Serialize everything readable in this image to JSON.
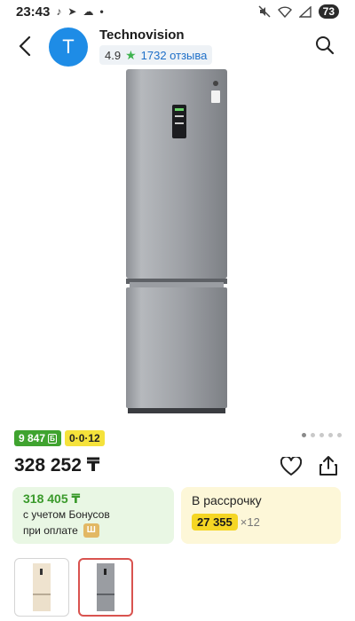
{
  "status_bar": {
    "time": "23:43",
    "battery": "73"
  },
  "header": {
    "avatar_letter": "T",
    "seller_name": "Technovision",
    "rating": "4.9",
    "reviews": "1732 отзыва"
  },
  "product": {
    "bonus_badge": "9 847",
    "installment_badge": "0·0·12",
    "price": "328 252 ₸",
    "gallery_total_dots": 5,
    "gallery_active_dot": 1
  },
  "bonus_card": {
    "price": "318 405 ₸",
    "line1": "с учетом Бонусов",
    "line2": "при оплате"
  },
  "credit_card": {
    "title": "В рассрочку",
    "amount": "27 355",
    "months": "×12"
  },
  "colors": {
    "accent_blue": "#1e8ce6",
    "bonus_green": "#3fa32f",
    "installment_yellow": "#f5e23b",
    "selected_thumb_border": "#d9534f"
  }
}
